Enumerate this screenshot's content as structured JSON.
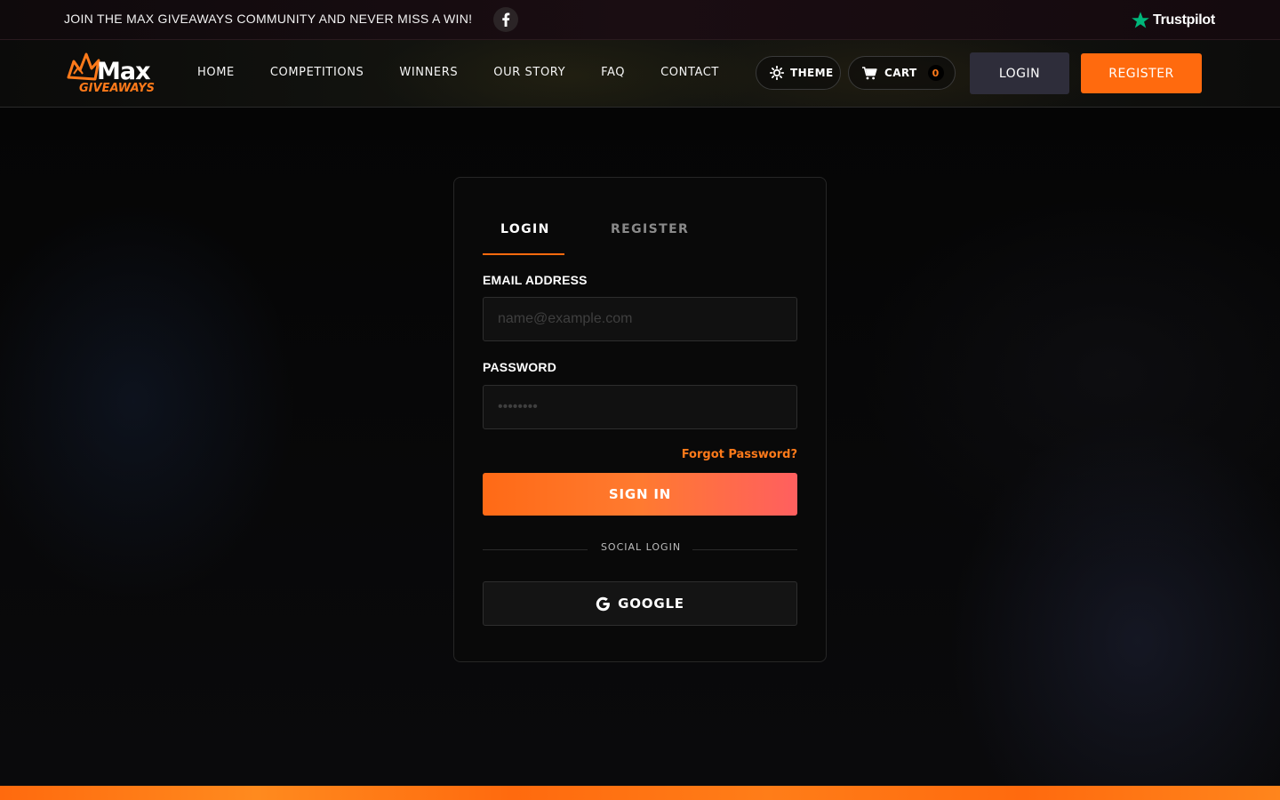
{
  "topbar": {
    "announcement": "JOIN THE MAX GIVEAWAYS COMMUNITY AND NEVER MISS A WIN!",
    "trustpilot_label": "Trustpilot"
  },
  "header": {
    "logo_top": "Max",
    "logo_bottom": "GIVEAWAYS",
    "nav": [
      "HOME",
      "COMPETITIONS",
      "WINNERS",
      "OUR STORY",
      "FAQ",
      "CONTACT"
    ],
    "theme_label": "THEME",
    "cart_label": "CART",
    "cart_count": "0",
    "login_label": "LOGIN",
    "register_label": "REGISTER"
  },
  "auth": {
    "tabs": {
      "login": "LOGIN",
      "register": "REGISTER"
    },
    "active_tab": "login",
    "email_label": "EMAIL ADDRESS",
    "email_placeholder": "name@example.com",
    "email_value": "",
    "password_label": "PASSWORD",
    "password_placeholder": "••••••••",
    "forgot_label": "Forgot Password?",
    "signin_label": "SIGN IN",
    "divider_label": "SOCIAL LOGIN",
    "google_label": "GOOGLE"
  },
  "colors": {
    "accent": "#ff6a0e",
    "login_button_bg": "#2e2d3a",
    "trustpilot_green": "#00b67a"
  }
}
